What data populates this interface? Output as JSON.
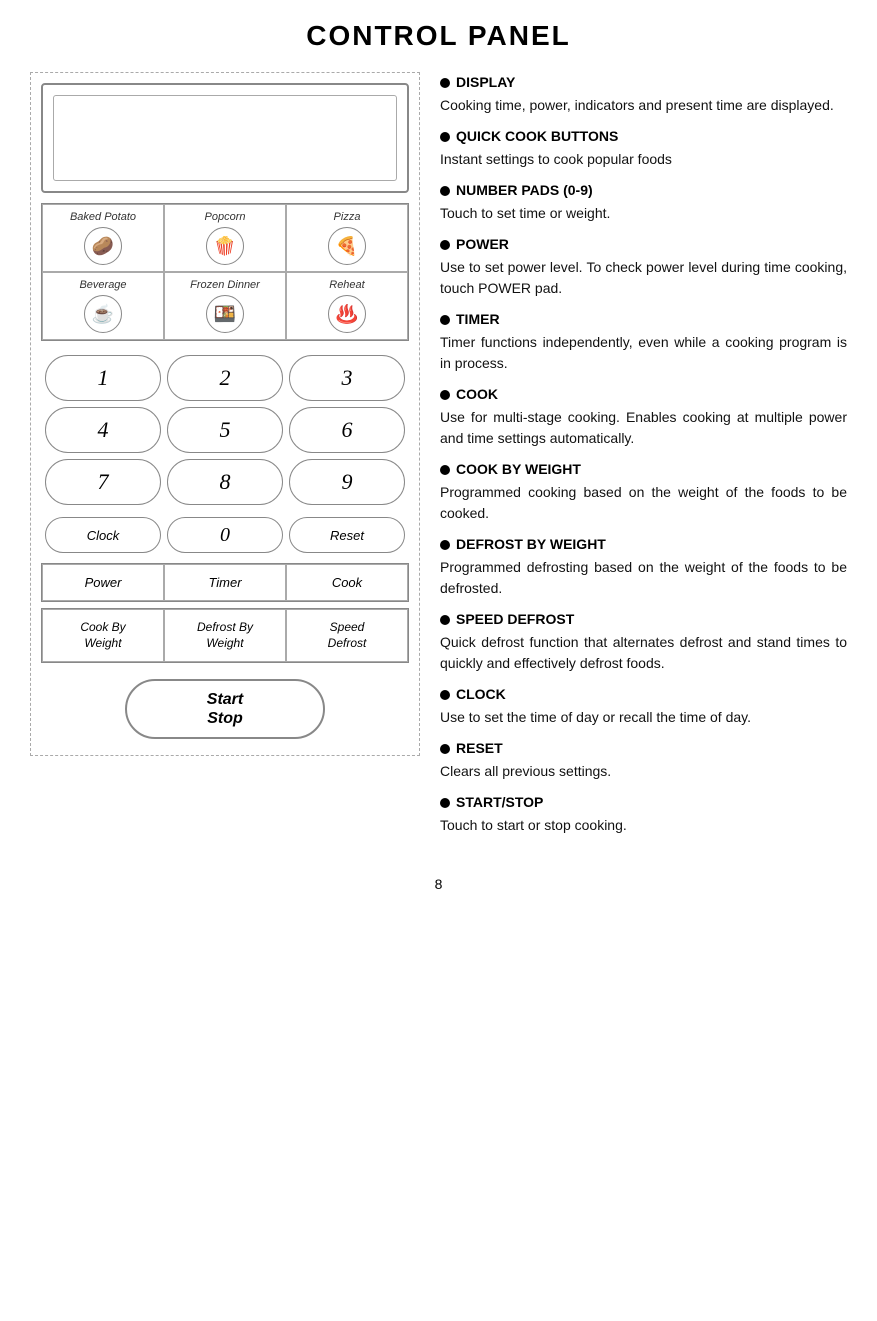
{
  "title": "CONTROL PANEL",
  "left_panel": {
    "quick_cook_buttons": [
      {
        "label": "Baked Potato",
        "icon": "🥔"
      },
      {
        "label": "Popcorn",
        "icon": "🍿"
      },
      {
        "label": "Pizza",
        "icon": "🍕"
      },
      {
        "label": "Beverage",
        "icon": "☕"
      },
      {
        "label": "Frozen Dinner",
        "icon": "🍱"
      },
      {
        "label": "Reheat",
        "icon": "♨️"
      }
    ],
    "numpad": [
      "1",
      "2",
      "3",
      "4",
      "5",
      "6",
      "7",
      "8",
      "9"
    ],
    "bottom_row": [
      "Clock",
      "0",
      "Reset"
    ],
    "func_row1": [
      "Power",
      "Timer",
      "Cook"
    ],
    "func_row2": [
      "Cook By\nWeight",
      "Defrost By\nWeight",
      "Speed\nDefrost"
    ],
    "start_stop": "Start\nStop"
  },
  "right_panel": {
    "items": [
      {
        "heading": "DISPLAY",
        "text": "Cooking time, power, indicators and present time are displayed."
      },
      {
        "heading": "QUICK COOK BUTTONS",
        "text": "Instant settings to cook popular foods"
      },
      {
        "heading": "NUMBER PADS (0-9)",
        "text": "Touch to set time or weight."
      },
      {
        "heading": "POWER",
        "text": "Use to set power level. To check power level during time cooking, touch POWER pad."
      },
      {
        "heading": "TIMER",
        "text": "Timer functions independently, even while a cooking program is in process."
      },
      {
        "heading": "COOK",
        "text": "Use for multi-stage cooking.   Enables cooking at multiple power and time settings automatically."
      },
      {
        "heading": "COOK BY WEIGHT",
        "text": "Programmed cooking based on the weight of the foods to be cooked."
      },
      {
        "heading": "DEFROST BY WEIGHT",
        "text": "Programmed defrosting based on the weight of the foods to be defrosted."
      },
      {
        "heading": "SPEED DEFROST",
        "text": "Quick defrost function that alternates defrost and stand times to quickly and effectively defrost foods."
      },
      {
        "heading": "CLOCK",
        "text": "Use to set the time of day or recall the time of day."
      },
      {
        "heading": "RESET",
        "text": "Clears all previous settings."
      },
      {
        "heading": "START/STOP",
        "text": "Touch to start or stop cooking."
      }
    ]
  },
  "page_number": "8"
}
